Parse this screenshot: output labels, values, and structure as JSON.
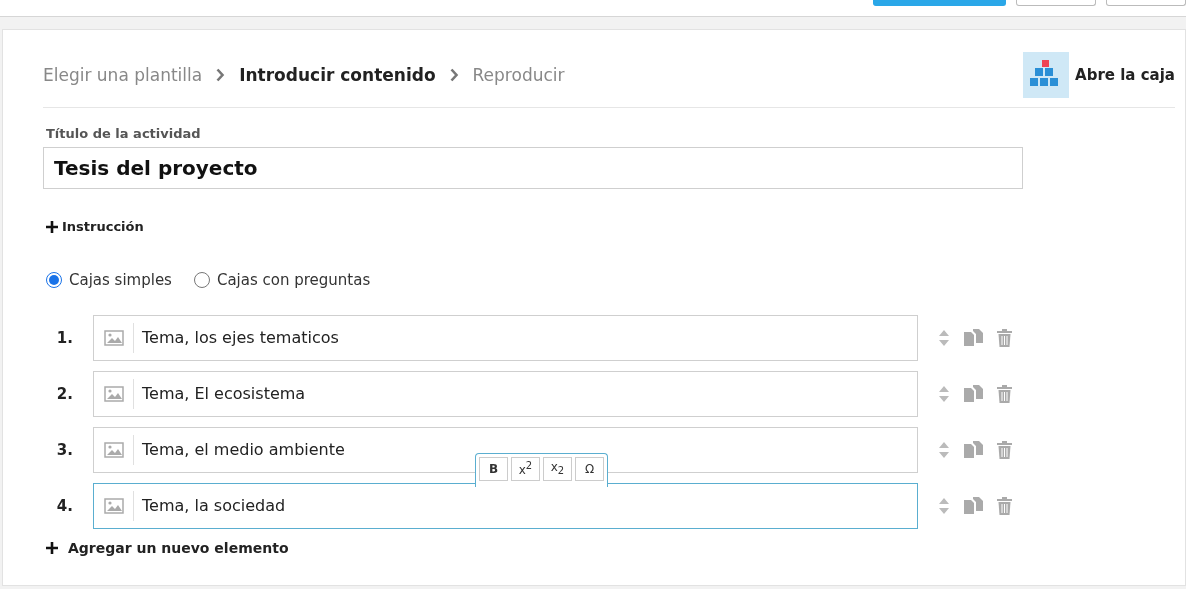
{
  "top_bar": {
    "buttons": [
      {
        "kind": "primary"
      },
      {
        "kind": "outline"
      },
      {
        "kind": "outline"
      }
    ]
  },
  "steps": [
    {
      "label": "Elegir una plantilla",
      "selected": false
    },
    {
      "label": "Introducir contenido",
      "selected": true
    },
    {
      "label": "Reproducir",
      "selected": false
    }
  ],
  "template": {
    "name": "Abre la caja"
  },
  "title_field": {
    "label": "Título de la actividad",
    "value": "Tesis del proyecto"
  },
  "instruction_link": "Instrucción",
  "modes": [
    {
      "label": "Cajas simples",
      "selected": true
    },
    {
      "label": "Cajas con preguntas",
      "selected": false
    }
  ],
  "items": [
    {
      "number": "1.",
      "value": "Tema, los ejes tematicos",
      "focused": false
    },
    {
      "number": "2.",
      "value": "Tema, El ecosistema",
      "focused": false
    },
    {
      "number": "3.",
      "value": "Tema, el medio ambiente",
      "focused": false
    },
    {
      "number": "4.",
      "value": "Tema, la sociedad",
      "focused": true
    }
  ],
  "format_toolbar": [
    "B",
    "x$^{2}$",
    "x$_{2}$",
    "Ω"
  ],
  "add_item": "Agregar un nuevo elemento"
}
